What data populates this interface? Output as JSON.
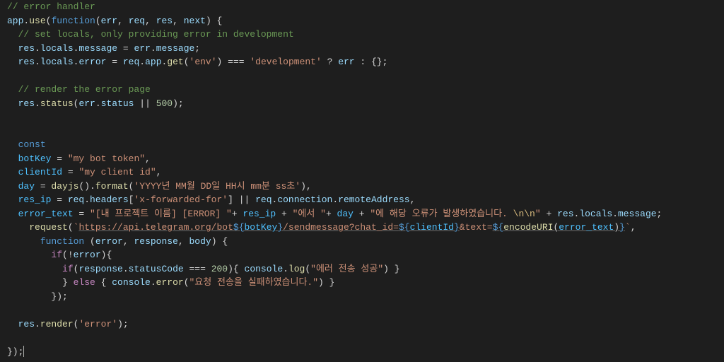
{
  "lines": {
    "l1": "// error handler",
    "l2_a": "app",
    "l2_b": ".",
    "l2_c": "use",
    "l2_d": "(",
    "l2_e": "function",
    "l2_f": "(",
    "l2_g": "err",
    "l2_h": ", ",
    "l2_i": "req",
    "l2_j": ", ",
    "l2_k": "res",
    "l2_l": ", ",
    "l2_m": "next",
    "l2_n": ") {",
    "l3": "  // set locals, only providing error in development",
    "l4_a": "  ",
    "l4_b": "res",
    "l4_c": ".",
    "l4_d": "locals",
    "l4_e": ".",
    "l4_f": "message",
    "l4_g": " = ",
    "l4_h": "err",
    "l4_i": ".",
    "l4_j": "message",
    "l4_k": ";",
    "l5_a": "  ",
    "l5_b": "res",
    "l5_c": ".",
    "l5_d": "locals",
    "l5_e": ".",
    "l5_f": "error",
    "l5_g": " = ",
    "l5_h": "req",
    "l5_i": ".",
    "l5_j": "app",
    "l5_k": ".",
    "l5_l": "get",
    "l5_m": "(",
    "l5_n": "'env'",
    "l5_o": ") === ",
    "l5_p": "'development'",
    "l5_q": " ? ",
    "l5_r": "err",
    "l5_s": " : {};",
    "l7": "  // render the error page",
    "l8_a": "  ",
    "l8_b": "res",
    "l8_c": ".",
    "l8_d": "status",
    "l8_e": "(",
    "l8_f": "err",
    "l8_g": ".",
    "l8_h": "status",
    "l8_i": " || ",
    "l8_j": "500",
    "l8_k": ");",
    "l11_a": "  ",
    "l11_b": "const",
    "l12_a": "  ",
    "l12_b": "botKey",
    "l12_c": " = ",
    "l12_d": "\"my bot token\"",
    "l12_e": ",",
    "l13_a": "  ",
    "l13_b": "clientId",
    "l13_c": " = ",
    "l13_d": "\"my client id\"",
    "l13_e": ",",
    "l14_a": "  ",
    "l14_b": "day",
    "l14_c": " = ",
    "l14_d": "dayjs",
    "l14_e": "().",
    "l14_f": "format",
    "l14_g": "(",
    "l14_h": "'YYYY년 MM월 DD일 HH시 mm분 ss초'",
    "l14_i": "),",
    "l15_a": "  ",
    "l15_b": "res_ip",
    "l15_c": " = ",
    "l15_d": "req",
    "l15_e": ".",
    "l15_f": "headers",
    "l15_g": "[",
    "l15_h": "'x-forwarded-for'",
    "l15_i": "] || ",
    "l15_j": "req",
    "l15_k": ".",
    "l15_l": "connection",
    "l15_m": ".",
    "l15_n": "remoteAddress",
    "l15_o": ",",
    "l16_a": "  ",
    "l16_b": "error_text",
    "l16_c": " = ",
    "l16_d": "\"[내 프로젝트 이름] [ERROR] \"",
    "l16_e": "+ ",
    "l16_f": "res_ip",
    "l16_g": " + ",
    "l16_h": "\"에서 \"",
    "l16_i": "+ ",
    "l16_j": "day",
    "l16_k": " + ",
    "l16_l": "\"에 해당 오류가 발생하였습니다. ",
    "l16_m": "\\n\\n",
    "l16_n": "\"",
    "l16_o": " + ",
    "l16_p": "res",
    "l16_q": ".",
    "l16_r": "locals",
    "l16_s": ".",
    "l16_t": "message",
    "l16_u": ";",
    "l17_a": "    ",
    "l17_b": "request",
    "l17_c": "(",
    "l17_d": "`",
    "l17_e": "https://api.telegram.org/bot",
    "l17_f": "${",
    "l17_g": "botKey",
    "l17_h": "}",
    "l17_i": "/sendmessage?chat_id=",
    "l17_j": "${",
    "l17_k": "clientId",
    "l17_l": "}",
    "l17_m": "&text=",
    "l17_n": "${",
    "l17_o": "encodeURI",
    "l17_p": "(",
    "l17_q": "error_text",
    "l17_r": ")",
    "l17_s": "}",
    "l17_t": "`",
    "l17_u": ",",
    "l18_a": "      ",
    "l18_b": "function",
    "l18_c": " (",
    "l18_d": "error",
    "l18_e": ", ",
    "l18_f": "response",
    "l18_g": ", ",
    "l18_h": "body",
    "l18_i": ") {",
    "l19_a": "        ",
    "l19_b": "if",
    "l19_c": "(!",
    "l19_d": "error",
    "l19_e": "){",
    "l20_a": "          ",
    "l20_b": "if",
    "l20_c": "(",
    "l20_d": "response",
    "l20_e": ".",
    "l20_f": "statusCode",
    "l20_g": " === ",
    "l20_h": "200",
    "l20_i": "){ ",
    "l20_j": "console",
    "l20_k": ".",
    "l20_l": "log",
    "l20_m": "(",
    "l20_n": "\"에러 전송 성공\"",
    "l20_o": ") }",
    "l21_a": "          } ",
    "l21_b": "else",
    "l21_c": " { ",
    "l21_d": "console",
    "l21_e": ".",
    "l21_f": "error",
    "l21_g": "(",
    "l21_h": "\"요청 전송을 실패하였습니다.\"",
    "l21_i": ") }",
    "l22": "        });",
    "l24_a": "  ",
    "l24_b": "res",
    "l24_c": ".",
    "l24_d": "render",
    "l24_e": "(",
    "l24_f": "'error'",
    "l24_g": ");",
    "l26": "});"
  }
}
